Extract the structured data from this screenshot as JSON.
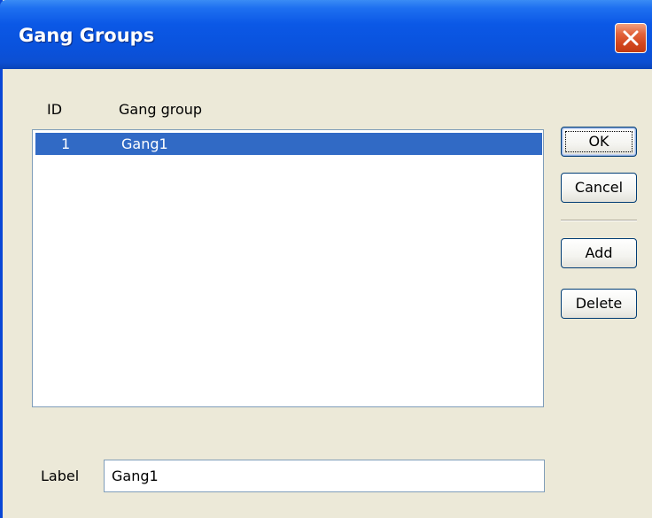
{
  "window": {
    "title": "Gang Groups"
  },
  "table": {
    "columns": [
      "ID",
      "Gang group"
    ],
    "rows": [
      {
        "id": "1",
        "name": "Gang1",
        "selected": true
      }
    ]
  },
  "buttons": {
    "ok": "OK",
    "cancel": "Cancel",
    "add": "Add",
    "delete": "Delete"
  },
  "label_field": {
    "label": "Label",
    "value": "Gang1"
  },
  "colors": {
    "titlebar": "#0a52dc",
    "selection": "#316ac5",
    "close": "#d2461c",
    "dialog_bg": "#ece9d8"
  },
  "icons": {
    "close": "close-icon"
  }
}
